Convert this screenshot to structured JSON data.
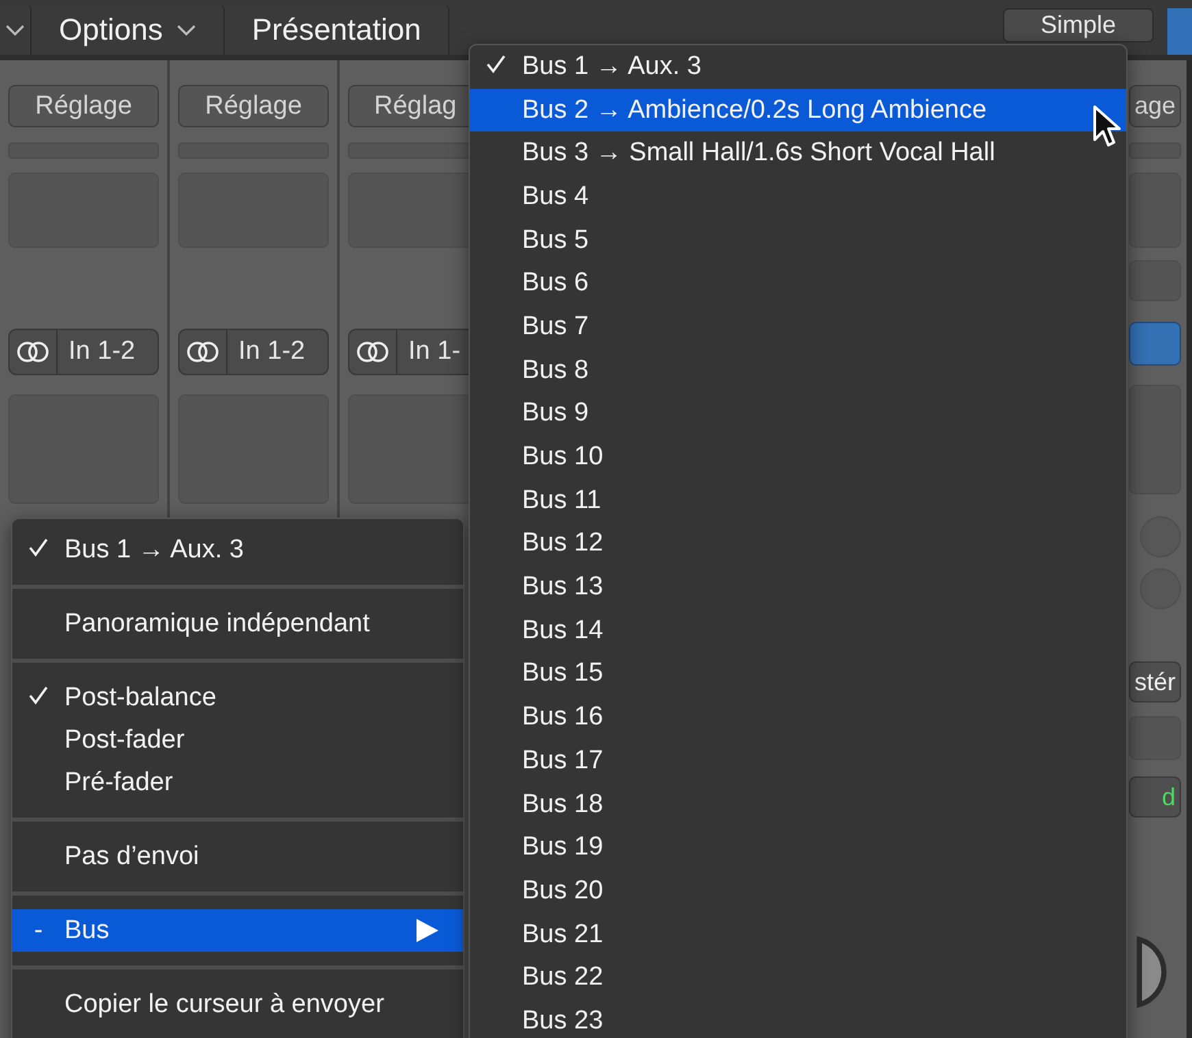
{
  "toolbar": {
    "menus": [
      {
        "label": "Options",
        "caret": true
      },
      {
        "label": "Présentation",
        "caret": false
      }
    ],
    "view_button": {
      "label": "Simple"
    }
  },
  "channels": [
    {
      "setting": "Réglage",
      "input": "In 1-2"
    },
    {
      "setting": "Réglage",
      "input": "In 1-2"
    },
    {
      "setting": "Réglag",
      "input": "In 1-"
    }
  ],
  "right_strip": {
    "setting": "age",
    "button_2": "stér",
    "button_3": "d"
  },
  "send_menu": {
    "items": [
      {
        "kind": "item",
        "label": "Bus 1 → Aux. 3",
        "checked": true,
        "selected": false
      },
      {
        "kind": "separator"
      },
      {
        "kind": "item",
        "label": "Panoramique indépendant",
        "checked": false,
        "selected": false
      },
      {
        "kind": "separator"
      },
      {
        "kind": "item",
        "label": "Post-balance",
        "checked": true,
        "selected": false
      },
      {
        "kind": "item",
        "label": "Post-fader",
        "checked": false,
        "selected": false
      },
      {
        "kind": "item",
        "label": "Pré-fader",
        "checked": false,
        "selected": false
      },
      {
        "kind": "separator"
      },
      {
        "kind": "item",
        "label": "Pas d’envoi",
        "checked": false,
        "selected": false
      },
      {
        "kind": "separator"
      },
      {
        "kind": "submenu",
        "label": "Bus",
        "mark": "-",
        "selected": true
      },
      {
        "kind": "separator"
      },
      {
        "kind": "item",
        "label": "Copier le curseur à envoyer",
        "checked": false,
        "selected": false
      }
    ]
  },
  "bus_submenu": {
    "items": [
      {
        "label": "Bus 1 → Aux. 3",
        "checked": true,
        "selected": false
      },
      {
        "label": "Bus 2 → Ambience/0.2s Long Ambience",
        "checked": false,
        "selected": true
      },
      {
        "label": "Bus 3 → Small Hall/1.6s Short Vocal Hall",
        "checked": false,
        "selected": false
      },
      {
        "label": "Bus 4",
        "checked": false,
        "selected": false
      },
      {
        "label": "Bus 5",
        "checked": false,
        "selected": false
      },
      {
        "label": "Bus 6",
        "checked": false,
        "selected": false
      },
      {
        "label": "Bus 7",
        "checked": false,
        "selected": false
      },
      {
        "label": "Bus 8",
        "checked": false,
        "selected": false
      },
      {
        "label": "Bus 9",
        "checked": false,
        "selected": false
      },
      {
        "label": "Bus 10",
        "checked": false,
        "selected": false
      },
      {
        "label": "Bus 11",
        "checked": false,
        "selected": false
      },
      {
        "label": "Bus 12",
        "checked": false,
        "selected": false
      },
      {
        "label": "Bus 13",
        "checked": false,
        "selected": false
      },
      {
        "label": "Bus 14",
        "checked": false,
        "selected": false
      },
      {
        "label": "Bus 15",
        "checked": false,
        "selected": false
      },
      {
        "label": "Bus 16",
        "checked": false,
        "selected": false
      },
      {
        "label": "Bus 17",
        "checked": false,
        "selected": false
      },
      {
        "label": "Bus 18",
        "checked": false,
        "selected": false
      },
      {
        "label": "Bus 19",
        "checked": false,
        "selected": false
      },
      {
        "label": "Bus 20",
        "checked": false,
        "selected": false
      },
      {
        "label": "Bus 21",
        "checked": false,
        "selected": false
      },
      {
        "label": "Bus 22",
        "checked": false,
        "selected": false
      },
      {
        "label": "Bus 23",
        "checked": false,
        "selected": false
      }
    ]
  }
}
